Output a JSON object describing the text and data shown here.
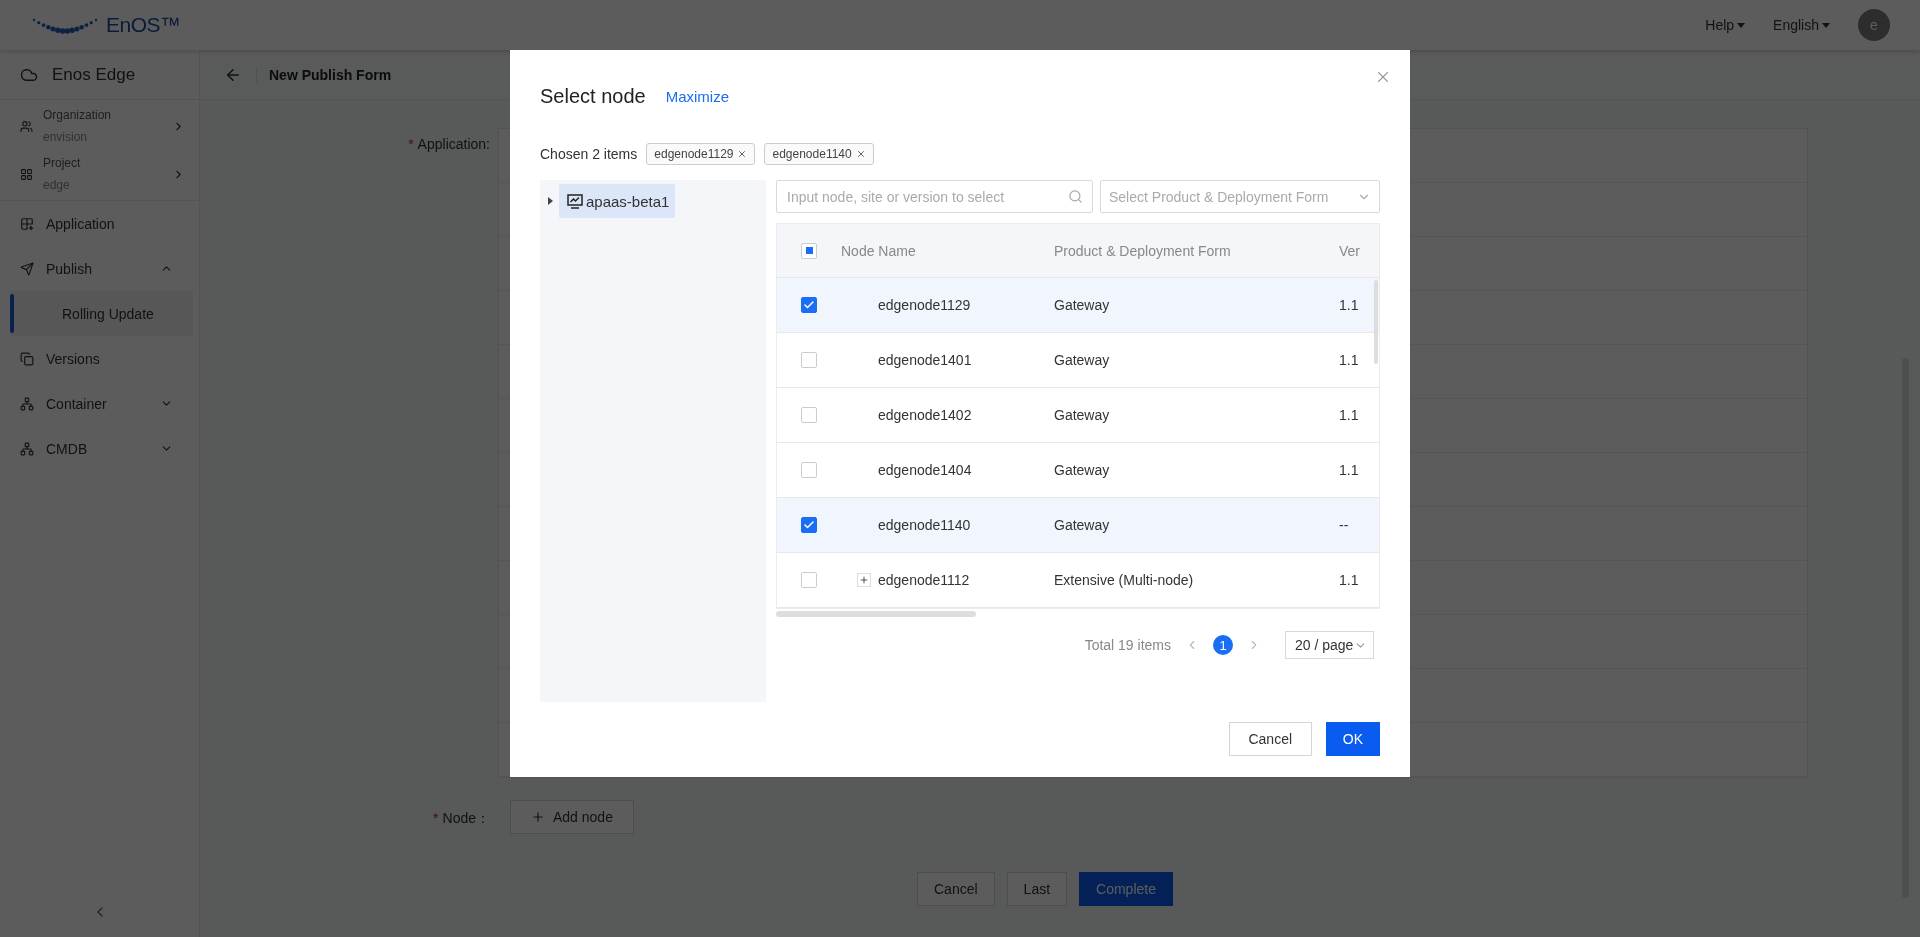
{
  "header": {
    "logo": "**En**OS™",
    "menus": [
      {
        "label": "Help"
      },
      {
        "label": "English"
      }
    ],
    "avatar": "e"
  },
  "sidebar": {
    "title": "Enos Edge",
    "contexts": [
      {
        "label": "Organization",
        "value": "envision"
      },
      {
        "label": "Project",
        "value": "edge"
      }
    ],
    "items": [
      {
        "label": "Application",
        "kind": "link"
      },
      {
        "label": "Publish",
        "kind": "group",
        "expanded": true,
        "children": [
          {
            "label": "Rolling Update",
            "selected": true
          }
        ]
      },
      {
        "label": "Versions",
        "kind": "link"
      },
      {
        "label": "Container",
        "kind": "group",
        "expanded": false
      },
      {
        "label": "CMDB",
        "kind": "group",
        "expanded": false
      }
    ]
  },
  "page": {
    "title": "New Publish Form",
    "fields": [
      {
        "label": "Application:",
        "required_mark": "*"
      },
      {
        "label": "Node：",
        "required_mark": "*",
        "button": "Add node"
      }
    ],
    "buttons": [
      {
        "label": "Cancel",
        "kind": "default"
      },
      {
        "label": "Last",
        "kind": "default"
      },
      {
        "label": "Complete",
        "kind": "primary"
      }
    ]
  },
  "dialog": {
    "title": "Select node",
    "link": "Maximize",
    "chosen_label": "Chosen 2 items",
    "chosen": [
      "edgenode1129",
      "edgenode1140"
    ],
    "tree": [
      {
        "label": "apaas-beta1",
        "expanded": false,
        "selected": true
      }
    ],
    "search": {
      "placeholder": "Input node, site or version to select"
    },
    "filter": {
      "placeholder": "Select Product & Deployment Form"
    },
    "table": {
      "columns": [
        "Node Name",
        "Product & Deployment Form",
        "Ver"
      ],
      "indeterminate": true,
      "rows": [
        {
          "name": "edgenode1129",
          "form": "Gateway",
          "version": "1.1",
          "checked": true,
          "expandable": false
        },
        {
          "name": "edgenode1401",
          "form": "Gateway",
          "version": "1.1",
          "checked": false,
          "expandable": false
        },
        {
          "name": "edgenode1402",
          "form": "Gateway",
          "version": "1.1",
          "checked": false,
          "expandable": false
        },
        {
          "name": "edgenode1404",
          "form": "Gateway",
          "version": "1.1",
          "checked": false,
          "expandable": false
        },
        {
          "name": "edgenode1140",
          "form": "Gateway",
          "version": "--",
          "checked": true,
          "expandable": false
        },
        {
          "name": "edgenode1112",
          "form": "Extensive (Multi-node)",
          "version": "1.1",
          "checked": false,
          "expandable": true
        }
      ]
    },
    "pagination": {
      "total": "Total 19 items",
      "pages": [
        {
          "label": "1",
          "selected": true
        }
      ],
      "page_size": "20 / page"
    },
    "buttons": [
      {
        "label": "Cancel",
        "kind": "default"
      },
      {
        "label": "OK",
        "kind": "primary"
      }
    ]
  }
}
